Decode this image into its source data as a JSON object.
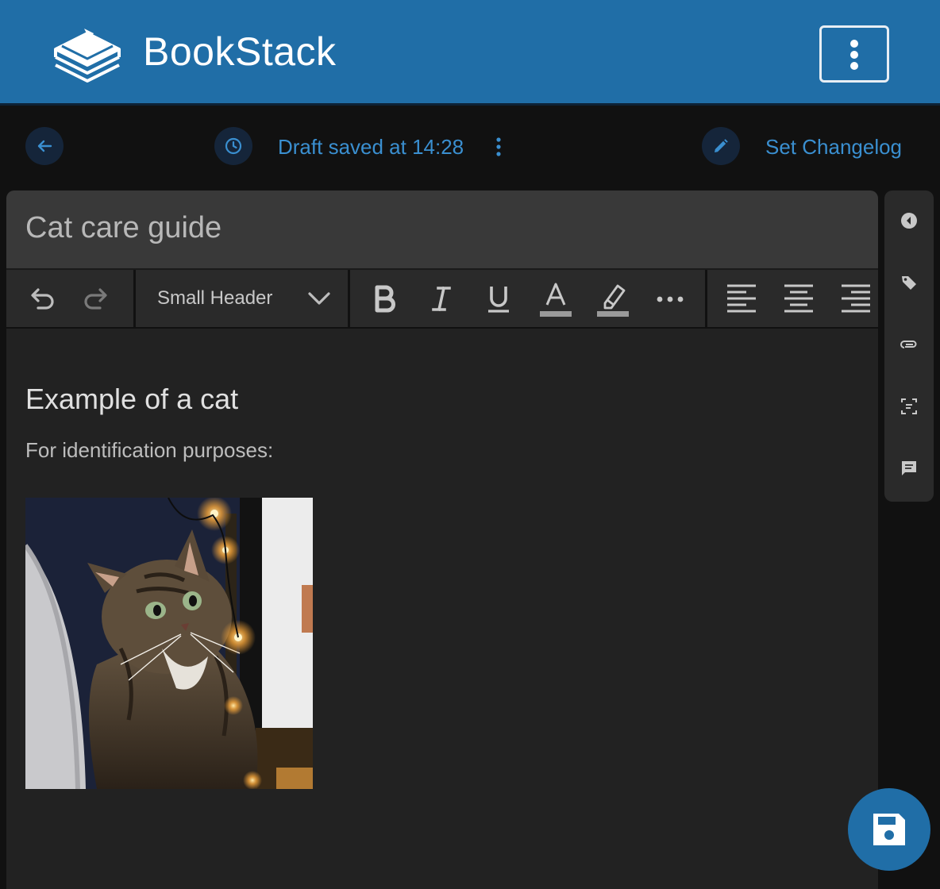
{
  "header": {
    "app_name": "BookStack",
    "logo_icon": "bookstack-logo-icon",
    "menu_icon": "more-vertical-icon"
  },
  "editor_toolbar": {
    "back_icon": "arrow-left-icon",
    "draft_icon": "clock-icon",
    "draft_status": "Draft saved at 14:28",
    "draft_menu_icon": "more-vertical-icon",
    "changelog_icon": "pencil-icon",
    "changelog_label": "Set Changelog"
  },
  "page": {
    "title": "Cat care guide"
  },
  "format_toolbar": {
    "block_format": "Small Header",
    "icons": [
      "undo-icon",
      "redo-icon",
      "chevron-down-icon",
      "bold-icon",
      "italic-icon",
      "underline-icon",
      "text-color-icon",
      "highlight-icon",
      "more-horizontal-icon",
      "align-left-icon",
      "align-center-icon",
      "align-right-icon"
    ]
  },
  "content": {
    "heading": "Example of a cat",
    "paragraph": "For identification purposes:"
  },
  "side_toolbar": {
    "icons": [
      "collapse-left-icon",
      "tag-icon",
      "attachment-icon",
      "templates-icon",
      "comment-icon"
    ]
  },
  "save_icon": "save-icon",
  "colors": {
    "brand": "#206ea7",
    "link": "#3a8fd0",
    "editor_bg": "#222222"
  }
}
